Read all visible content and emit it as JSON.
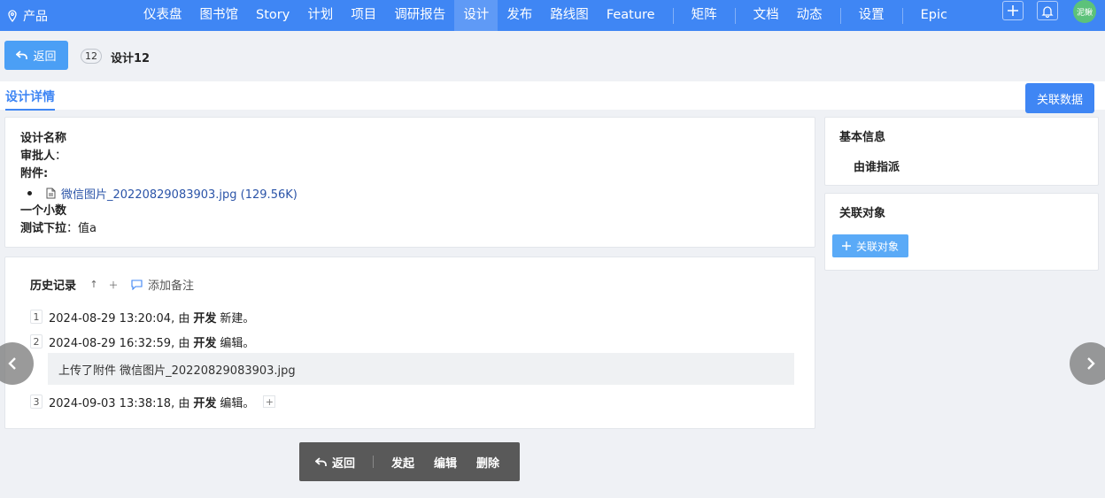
{
  "topbar": {
    "product": "产品",
    "nav": [
      "仪表盘",
      "图书馆",
      "Story",
      "计划",
      "项目",
      "调研报告",
      "设计",
      "发布",
      "路线图",
      "Feature",
      "矩阵",
      "文档",
      "动态",
      "设置",
      "Epic"
    ],
    "active_index": 6,
    "avatar_text": "泥鳅",
    "accent_color": "#3f86f4"
  },
  "header": {
    "back_label": "返回",
    "id_badge": "12",
    "title": "设计12"
  },
  "tabs": {
    "active": "设计详情",
    "link_data_label": "关联数据"
  },
  "detail": {
    "design_name_label": "设计名称",
    "approver_label": "审批人",
    "approver_sep": "：",
    "attachments_label": "附件:",
    "attachment_file": "微信图片_20220829083903.jpg (129.56K)",
    "decimal_label": "一个小数",
    "dropdown_label": "测试下拉",
    "dropdown_value": "：值a"
  },
  "history": {
    "title": "历史记录",
    "add_note": "添加备注",
    "items": [
      {
        "num": "1",
        "time": "2024-08-29 13:20:04, 由",
        "user": "开发",
        "action": "新建。"
      },
      {
        "num": "2",
        "time": "2024-08-29 16:32:59, 由",
        "user": "开发",
        "action": "编辑。"
      },
      {
        "num": "3",
        "time": "2024-09-03 13:38:18, 由",
        "user": "开发",
        "action": "编辑。"
      }
    ],
    "note": "上传了附件 微信图片_20220829083903.jpg"
  },
  "sidebar": {
    "basic_title": "基本信息",
    "assigned_by": "由谁指派",
    "related_title": "关联对象",
    "related_btn": "关联对象"
  },
  "toolbar": {
    "back": "返回",
    "initiate": "发起",
    "edit": "编辑",
    "delete": "删除"
  }
}
